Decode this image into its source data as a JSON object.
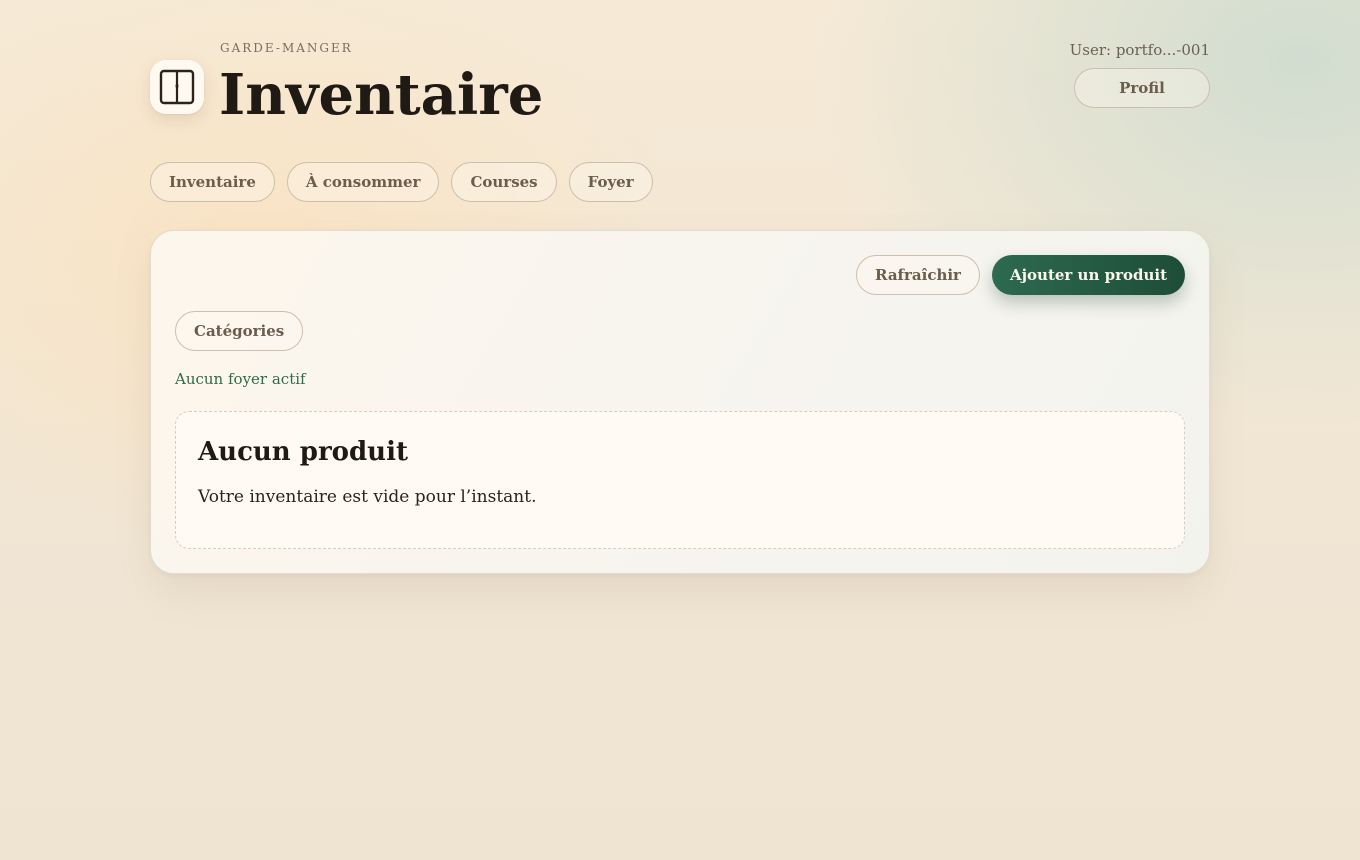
{
  "header": {
    "eyebrow": "GARDE-MANGER",
    "title": "Inventaire",
    "logo_icon": "pantry-cabinet-icon",
    "user_label": "User: portfo...-001",
    "profile_label": "Profil"
  },
  "nav": {
    "tabs": [
      {
        "label": "Inventaire"
      },
      {
        "label": "À consommer"
      },
      {
        "label": "Courses"
      },
      {
        "label": "Foyer"
      }
    ]
  },
  "main": {
    "refresh_label": "Rafraîchir",
    "add_product_label": "Ajouter un produit",
    "categories_label": "Catégories",
    "status": "Aucun foyer actif",
    "empty_state": {
      "title": "Aucun produit",
      "description": "Votre inventaire est vide pour l’instant."
    }
  },
  "colors": {
    "accent": "#2d6a4f",
    "status_text": "#2f6b4a",
    "text": "#1f1a14"
  }
}
